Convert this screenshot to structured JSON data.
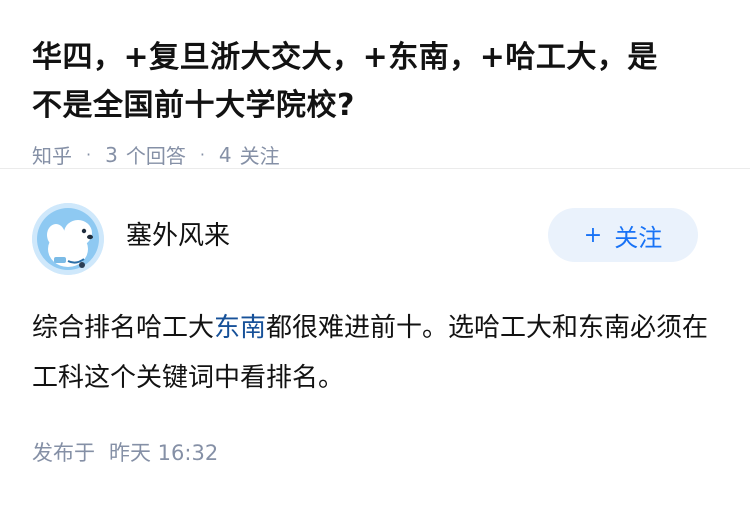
{
  "question": {
    "title": "华四，+复旦浙大交大，+东南，+哈工大，是不是全国前十大学院校?",
    "source": "知乎",
    "answer_count": "3",
    "answer_label": "个回答",
    "follow_count": "4",
    "follow_label": "关注"
  },
  "answer": {
    "author_name": "塞外风来",
    "follow_button_label": "关注",
    "content_before": "综合排名哈工大",
    "content_link": "东南",
    "content_after": "都很难进前十。选哈工大和东南必须在工科这个关键词中看排名。",
    "published_label": "发布于",
    "published_time": "昨天 16:32"
  },
  "colors": {
    "accent": "#1772f6",
    "link": "#175199",
    "meta": "#8590a6",
    "button_bg": "#eaf2fc"
  }
}
